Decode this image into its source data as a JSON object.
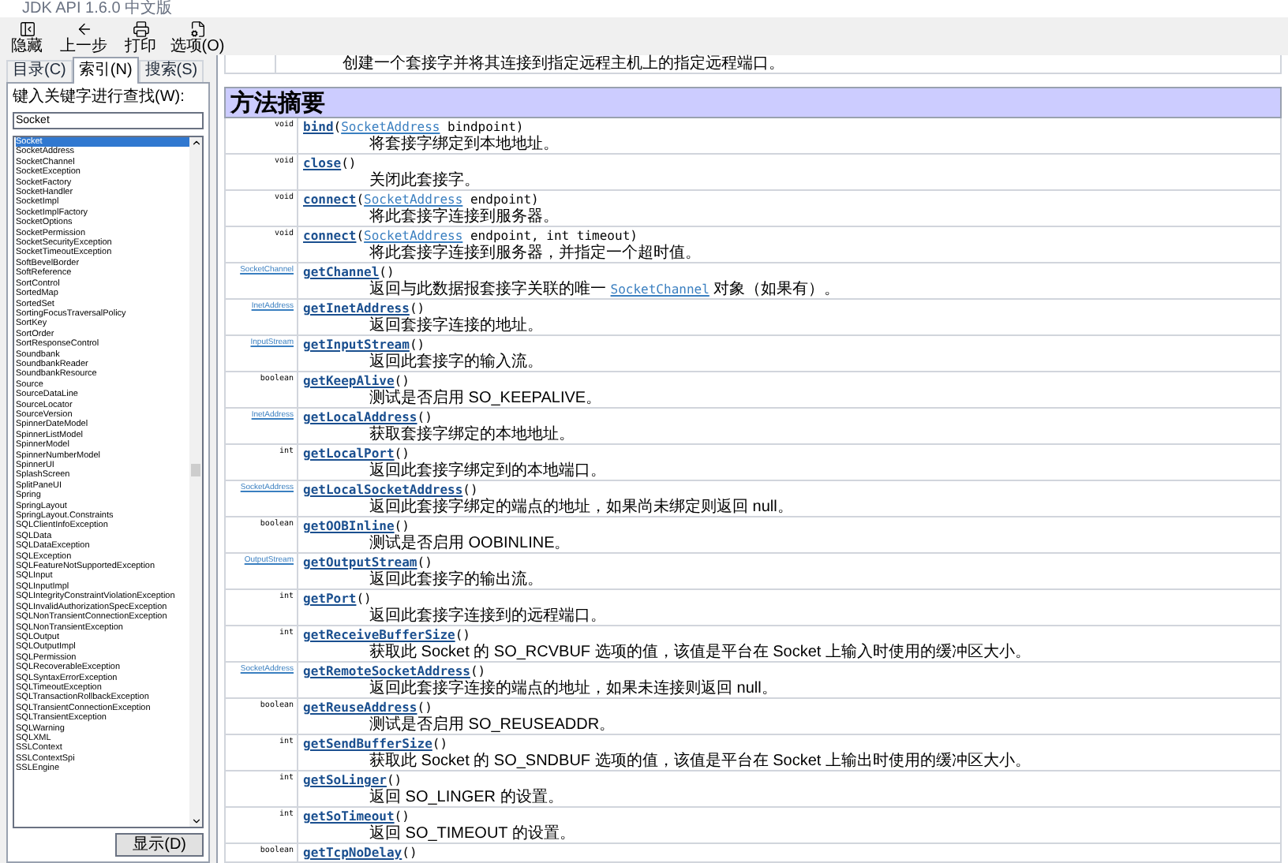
{
  "window": {
    "title": "JDK API 1.6.0 中文版"
  },
  "toolbar": [
    {
      "kind": "hide",
      "label": "隐藏"
    },
    {
      "kind": "back",
      "label": "上一步"
    },
    {
      "kind": "print",
      "label": "打印"
    },
    {
      "kind": "options",
      "label": "选项(O)"
    }
  ],
  "tabs": [
    {
      "label": "目录(C)",
      "selected": false
    },
    {
      "label": "索引(N)",
      "selected": true
    },
    {
      "label": "搜索(S)",
      "selected": false
    }
  ],
  "search": {
    "label": "键入关键字进行查找(W):",
    "value": "Socket"
  },
  "index_list": [
    {
      "label": "Socket",
      "selected": true
    },
    {
      "label": "SocketAddress",
      "selected": false
    },
    {
      "label": "SocketChannel",
      "selected": false
    },
    {
      "label": "SocketException",
      "selected": false
    },
    {
      "label": "SocketFactory",
      "selected": false
    },
    {
      "label": "SocketHandler",
      "selected": false
    },
    {
      "label": "SocketImpl",
      "selected": false
    },
    {
      "label": "SocketImplFactory",
      "selected": false
    },
    {
      "label": "SocketOptions",
      "selected": false
    },
    {
      "label": "SocketPermission",
      "selected": false
    },
    {
      "label": "SocketSecurityException",
      "selected": false
    },
    {
      "label": "SocketTimeoutException",
      "selected": false
    },
    {
      "label": "SoftBevelBorder",
      "selected": false
    },
    {
      "label": "SoftReference",
      "selected": false
    },
    {
      "label": "SortControl",
      "selected": false
    },
    {
      "label": "SortedMap",
      "selected": false
    },
    {
      "label": "SortedSet",
      "selected": false
    },
    {
      "label": "SortingFocusTraversalPolicy",
      "selected": false
    },
    {
      "label": "SortKey",
      "selected": false
    },
    {
      "label": "SortOrder",
      "selected": false
    },
    {
      "label": "SortResponseControl",
      "selected": false
    },
    {
      "label": "Soundbank",
      "selected": false
    },
    {
      "label": "SoundbankReader",
      "selected": false
    },
    {
      "label": "SoundbankResource",
      "selected": false
    },
    {
      "label": "Source",
      "selected": false
    },
    {
      "label": "SourceDataLine",
      "selected": false
    },
    {
      "label": "SourceLocator",
      "selected": false
    },
    {
      "label": "SourceVersion",
      "selected": false
    },
    {
      "label": "SpinnerDateModel",
      "selected": false
    },
    {
      "label": "SpinnerListModel",
      "selected": false
    },
    {
      "label": "SpinnerModel",
      "selected": false
    },
    {
      "label": "SpinnerNumberModel",
      "selected": false
    },
    {
      "label": "SpinnerUI",
      "selected": false
    },
    {
      "label": "SplashScreen",
      "selected": false
    },
    {
      "label": "SplitPaneUI",
      "selected": false
    },
    {
      "label": "Spring",
      "selected": false
    },
    {
      "label": "SpringLayout",
      "selected": false
    },
    {
      "label": "SpringLayout.Constraints",
      "selected": false
    },
    {
      "label": "SQLClientInfoException",
      "selected": false
    },
    {
      "label": "SQLData",
      "selected": false
    },
    {
      "label": "SQLDataException",
      "selected": false
    },
    {
      "label": "SQLException",
      "selected": false
    },
    {
      "label": "SQLFeatureNotSupportedException",
      "selected": false
    },
    {
      "label": "SQLInput",
      "selected": false
    },
    {
      "label": "SQLInputImpl",
      "selected": false
    },
    {
      "label": "SQLIntegrityConstraintViolationException",
      "selected": false
    },
    {
      "label": "SQLInvalidAuthorizationSpecException",
      "selected": false
    },
    {
      "label": "SQLNonTransientConnectionException",
      "selected": false
    },
    {
      "label": "SQLNonTransientException",
      "selected": false
    },
    {
      "label": "SQLOutput",
      "selected": false
    },
    {
      "label": "SQLOutputImpl",
      "selected": false
    },
    {
      "label": "SQLPermission",
      "selected": false
    },
    {
      "label": "SQLRecoverableException",
      "selected": false
    },
    {
      "label": "SQLSyntaxErrorException",
      "selected": false
    },
    {
      "label": "SQLTimeoutException",
      "selected": false
    },
    {
      "label": "SQLTransactionRollbackException",
      "selected": false
    },
    {
      "label": "SQLTransientConnectionException",
      "selected": false
    },
    {
      "label": "SQLTransientException",
      "selected": false
    },
    {
      "label": "SQLWarning",
      "selected": false
    },
    {
      "label": "SQLXML",
      "selected": false
    },
    {
      "label": "SSLContext",
      "selected": false
    },
    {
      "label": "SSLContextSpi",
      "selected": false
    },
    {
      "label": "SSLEngine",
      "selected": false
    }
  ],
  "display_button": "显示(D)",
  "previous_row": {
    "description": "创建一个套接字并将其连接到指定远程主机上的指定远程端口。"
  },
  "section_title": "方法摘要",
  "methods": [
    {
      "return_type": {
        "kind": "primitive",
        "text": "void"
      },
      "signature": [
        {
          "kind": "method",
          "text": "bind"
        },
        {
          "kind": "text",
          "text": "("
        },
        {
          "kind": "link",
          "text": "SocketAddress"
        },
        {
          "kind": "text",
          "text": " bindpoint)"
        }
      ],
      "description": [
        {
          "kind": "text",
          "text": "将套接字绑定到本地地址。"
        }
      ]
    },
    {
      "return_type": {
        "kind": "primitive",
        "text": "void"
      },
      "signature": [
        {
          "kind": "method",
          "text": "close"
        },
        {
          "kind": "text",
          "text": "()"
        }
      ],
      "description": [
        {
          "kind": "text",
          "text": "关闭此套接字。"
        }
      ]
    },
    {
      "return_type": {
        "kind": "primitive",
        "text": "void"
      },
      "signature": [
        {
          "kind": "method",
          "text": "connect"
        },
        {
          "kind": "text",
          "text": "("
        },
        {
          "kind": "link",
          "text": "SocketAddress"
        },
        {
          "kind": "text",
          "text": " endpoint)"
        }
      ],
      "description": [
        {
          "kind": "text",
          "text": "将此套接字连接到服务器。"
        }
      ]
    },
    {
      "return_type": {
        "kind": "primitive",
        "text": "void"
      },
      "signature": [
        {
          "kind": "method",
          "text": "connect"
        },
        {
          "kind": "text",
          "text": "("
        },
        {
          "kind": "link",
          "text": "SocketAddress"
        },
        {
          "kind": "text",
          "text": " endpoint, int timeout)"
        }
      ],
      "description": [
        {
          "kind": "text",
          "text": "将此套接字连接到服务器，并指定一个超时值。"
        }
      ]
    },
    {
      "return_type": {
        "kind": "link",
        "text": "SocketChannel"
      },
      "signature": [
        {
          "kind": "method",
          "text": "getChannel"
        },
        {
          "kind": "text",
          "text": "()"
        }
      ],
      "description": [
        {
          "kind": "text",
          "text": "返回与此数据报套接字关联的唯一 "
        },
        {
          "kind": "link",
          "text": "SocketChannel"
        },
        {
          "kind": "text",
          "text": " 对象（如果有）。"
        }
      ]
    },
    {
      "return_type": {
        "kind": "link",
        "text": "InetAddress"
      },
      "signature": [
        {
          "kind": "method",
          "text": "getInetAddress"
        },
        {
          "kind": "text",
          "text": "()"
        }
      ],
      "description": [
        {
          "kind": "text",
          "text": "返回套接字连接的地址。"
        }
      ]
    },
    {
      "return_type": {
        "kind": "link",
        "text": "InputStream"
      },
      "signature": [
        {
          "kind": "method",
          "text": "getInputStream"
        },
        {
          "kind": "text",
          "text": "()"
        }
      ],
      "description": [
        {
          "kind": "text",
          "text": "返回此套接字的输入流。"
        }
      ]
    },
    {
      "return_type": {
        "kind": "primitive",
        "text": "boolean"
      },
      "signature": [
        {
          "kind": "method",
          "text": "getKeepAlive"
        },
        {
          "kind": "text",
          "text": "()"
        }
      ],
      "description": [
        {
          "kind": "text",
          "text": "测试是否启用 SO_KEEPALIVE。"
        }
      ]
    },
    {
      "return_type": {
        "kind": "link",
        "text": "InetAddress"
      },
      "signature": [
        {
          "kind": "method",
          "text": "getLocalAddress"
        },
        {
          "kind": "text",
          "text": "()"
        }
      ],
      "description": [
        {
          "kind": "text",
          "text": "获取套接字绑定的本地地址。"
        }
      ]
    },
    {
      "return_type": {
        "kind": "primitive",
        "text": "int"
      },
      "signature": [
        {
          "kind": "method",
          "text": "getLocalPort"
        },
        {
          "kind": "text",
          "text": "()"
        }
      ],
      "description": [
        {
          "kind": "text",
          "text": "返回此套接字绑定到的本地端口。"
        }
      ]
    },
    {
      "return_type": {
        "kind": "link",
        "text": "SocketAddress"
      },
      "signature": [
        {
          "kind": "method",
          "text": "getLocalSocketAddress"
        },
        {
          "kind": "text",
          "text": "()"
        }
      ],
      "description": [
        {
          "kind": "text",
          "text": "返回此套接字绑定的端点的地址，如果尚未绑定则返回 null。"
        }
      ]
    },
    {
      "return_type": {
        "kind": "primitive",
        "text": "boolean"
      },
      "signature": [
        {
          "kind": "method",
          "text": "getOOBInline"
        },
        {
          "kind": "text",
          "text": "()"
        }
      ],
      "description": [
        {
          "kind": "text",
          "text": "测试是否启用 OOBINLINE。"
        }
      ]
    },
    {
      "return_type": {
        "kind": "link",
        "text": "OutputStream"
      },
      "signature": [
        {
          "kind": "method",
          "text": "getOutputStream"
        },
        {
          "kind": "text",
          "text": "()"
        }
      ],
      "description": [
        {
          "kind": "text",
          "text": "返回此套接字的输出流。"
        }
      ]
    },
    {
      "return_type": {
        "kind": "primitive",
        "text": "int"
      },
      "signature": [
        {
          "kind": "method",
          "text": "getPort"
        },
        {
          "kind": "text",
          "text": "()"
        }
      ],
      "description": [
        {
          "kind": "text",
          "text": "返回此套接字连接到的远程端口。"
        }
      ]
    },
    {
      "return_type": {
        "kind": "primitive",
        "text": "int"
      },
      "signature": [
        {
          "kind": "method",
          "text": "getReceiveBufferSize"
        },
        {
          "kind": "text",
          "text": "()"
        }
      ],
      "description": [
        {
          "kind": "text",
          "text": "获取此 Socket 的 SO_RCVBUF 选项的值，该值是平台在 Socket 上输入时使用的缓冲区大小。"
        }
      ]
    },
    {
      "return_type": {
        "kind": "link",
        "text": "SocketAddress"
      },
      "signature": [
        {
          "kind": "method",
          "text": "getRemoteSocketAddress"
        },
        {
          "kind": "text",
          "text": "()"
        }
      ],
      "description": [
        {
          "kind": "text",
          "text": "返回此套接字连接的端点的地址，如果未连接则返回 null。"
        }
      ]
    },
    {
      "return_type": {
        "kind": "primitive",
        "text": "boolean"
      },
      "signature": [
        {
          "kind": "method",
          "text": "getReuseAddress"
        },
        {
          "kind": "text",
          "text": "()"
        }
      ],
      "description": [
        {
          "kind": "text",
          "text": "测试是否启用 SO_REUSEADDR。"
        }
      ]
    },
    {
      "return_type": {
        "kind": "primitive",
        "text": "int"
      },
      "signature": [
        {
          "kind": "method",
          "text": "getSendBufferSize"
        },
        {
          "kind": "text",
          "text": "()"
        }
      ],
      "description": [
        {
          "kind": "text",
          "text": "获取此 Socket 的 SO_SNDBUF 选项的值，该值是平台在 Socket 上输出时使用的缓冲区大小。"
        }
      ]
    },
    {
      "return_type": {
        "kind": "primitive",
        "text": "int"
      },
      "signature": [
        {
          "kind": "method",
          "text": "getSoLinger"
        },
        {
          "kind": "text",
          "text": "()"
        }
      ],
      "description": [
        {
          "kind": "text",
          "text": "返回 SO_LINGER 的设置。"
        }
      ]
    },
    {
      "return_type": {
        "kind": "primitive",
        "text": "int"
      },
      "signature": [
        {
          "kind": "method",
          "text": "getSoTimeout"
        },
        {
          "kind": "text",
          "text": "()"
        }
      ],
      "description": [
        {
          "kind": "text",
          "text": "返回 SO_TIMEOUT 的设置。"
        }
      ]
    },
    {
      "return_type": {
        "kind": "primitive",
        "text": "boolean"
      },
      "signature": [
        {
          "kind": "method",
          "text": "getTcpNoDelay"
        },
        {
          "kind": "text",
          "text": "()"
        }
      ]
    }
  ]
}
